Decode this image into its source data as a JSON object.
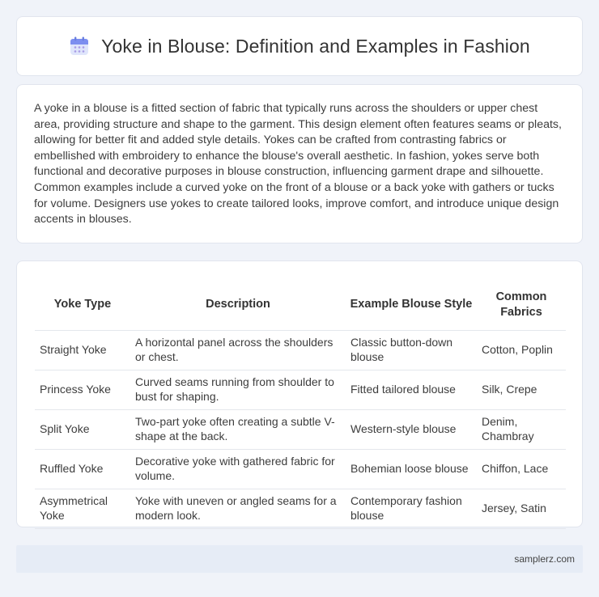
{
  "header": {
    "title": "Yoke in Blouse: Definition and Examples in Fashion",
    "icon": "calendar-icon"
  },
  "intro": {
    "text": "A yoke in a blouse is a fitted section of fabric that typically runs across the shoulders or upper chest area, providing structure and shape to the garment. This design element often features seams or pleats, allowing for better fit and added style details. Yokes can be crafted from contrasting fabrics or embellished with embroidery to enhance the blouse's overall aesthetic. In fashion, yokes serve both functional and decorative purposes in blouse construction, influencing garment drape and silhouette. Common examples include a curved yoke on the front of a blouse or a back yoke with gathers or tucks for volume. Designers use yokes to create tailored looks, improve comfort, and introduce unique design accents in blouses."
  },
  "table": {
    "headers": [
      "Yoke Type",
      "Description",
      "Example Blouse Style",
      "Common Fabrics"
    ],
    "rows": [
      [
        "Straight Yoke",
        "A horizontal panel across the shoulders or chest.",
        "Classic button-down blouse",
        "Cotton, Poplin"
      ],
      [
        "Princess Yoke",
        "Curved seams running from shoulder to bust for shaping.",
        "Fitted tailored blouse",
        "Silk, Crepe"
      ],
      [
        "Split Yoke",
        "Two-part yoke often creating a subtle V-shape at the back.",
        "Western-style blouse",
        "Denim, Chambray"
      ],
      [
        "Ruffled Yoke",
        "Decorative yoke with gathered fabric for volume.",
        "Bohemian loose blouse",
        "Chiffon, Lace"
      ],
      [
        "Asymmetrical Yoke",
        "Yoke with uneven or angled seams for a modern look.",
        "Contemporary fashion blouse",
        "Jersey, Satin"
      ]
    ]
  },
  "footer": {
    "text": "samplerz.com"
  },
  "colors": {
    "background": "#f0f3f9",
    "card": "#ffffff",
    "footer": "#e6ecf6",
    "icon_accent": "#6a7fe0"
  }
}
